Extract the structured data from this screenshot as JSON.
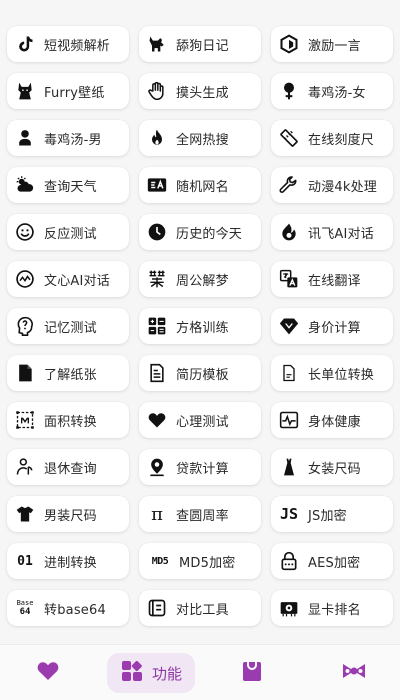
{
  "colors": {
    "accent": "#9b3bb0",
    "accent_bg": "#f0e6f4",
    "tile_bg": "#ffffff",
    "page_bg": "#f6f6f7"
  },
  "tools": [
    {
      "label": "短视频解析",
      "icon": "tiktok-icon"
    },
    {
      "label": "舔狗日记",
      "icon": "dog-icon"
    },
    {
      "label": "激励一言",
      "icon": "hexagon-icon"
    },
    {
      "label": "Furry壁纸",
      "icon": "fox-icon"
    },
    {
      "label": "摸头生成",
      "icon": "hand-icon"
    },
    {
      "label": "毒鸡汤-女",
      "icon": "female-icon"
    },
    {
      "label": "毒鸡汤-男",
      "icon": "male-icon"
    },
    {
      "label": "全网热搜",
      "icon": "flame-icon"
    },
    {
      "label": "在线刻度尺",
      "icon": "ruler-icon"
    },
    {
      "label": "查询天气",
      "icon": "weather-icon"
    },
    {
      "label": "随机网名",
      "icon": "id-card-icon"
    },
    {
      "label": "动漫4k处理",
      "icon": "wrench-icon"
    },
    {
      "label": "反应测试",
      "icon": "smile-icon"
    },
    {
      "label": "历史的今天",
      "icon": "clock-icon"
    },
    {
      "label": "讯飞AI对话",
      "icon": "xunfei-icon"
    },
    {
      "label": "文心AI对话",
      "icon": "wenxin-icon"
    },
    {
      "label": "周公解梦",
      "icon": "dream-icon"
    },
    {
      "label": "在线翻译",
      "icon": "translate-icon"
    },
    {
      "label": "记忆测试",
      "icon": "brain-icon"
    },
    {
      "label": "方格训练",
      "icon": "grid-icon"
    },
    {
      "label": "身价计算",
      "icon": "diamond-icon"
    },
    {
      "label": "了解纸张",
      "icon": "paper-icon"
    },
    {
      "label": "简历模板",
      "icon": "resume-icon"
    },
    {
      "label": "长单位转换",
      "icon": "document-icon"
    },
    {
      "label": "面积转换",
      "icon": "area-icon"
    },
    {
      "label": "心理测试",
      "icon": "heart-icon"
    },
    {
      "label": "身体健康",
      "icon": "pulse-icon"
    },
    {
      "label": "退休查询",
      "icon": "retire-icon"
    },
    {
      "label": "贷款计算",
      "icon": "location-icon"
    },
    {
      "label": "女装尺码",
      "icon": "dress-icon"
    },
    {
      "label": "男装尺码",
      "icon": "shirt-icon"
    },
    {
      "label": "查圆周率",
      "icon": "pi-icon"
    },
    {
      "label": "JS加密",
      "icon": "js-icon"
    },
    {
      "label": "进制转换",
      "icon": "binary-icon"
    },
    {
      "label": "MD5加密",
      "icon": "md5-icon"
    },
    {
      "label": "AES加密",
      "icon": "lock-icon"
    },
    {
      "label": "转base64",
      "icon": "base64-icon"
    },
    {
      "label": "对比工具",
      "icon": "compare-icon"
    },
    {
      "label": "显卡排名",
      "icon": "gpu-icon"
    }
  ],
  "icon_text": {
    "pi": "π",
    "js": "JS",
    "binary": "01",
    "md5": "MD5",
    "base_top": "Base",
    "base_bottom": "64"
  },
  "tabbar": {
    "active_label": "功能",
    "tabs": [
      "favorites-heart-icon",
      "functions-grid-icon",
      "bag-icon",
      "bow-icon"
    ]
  }
}
